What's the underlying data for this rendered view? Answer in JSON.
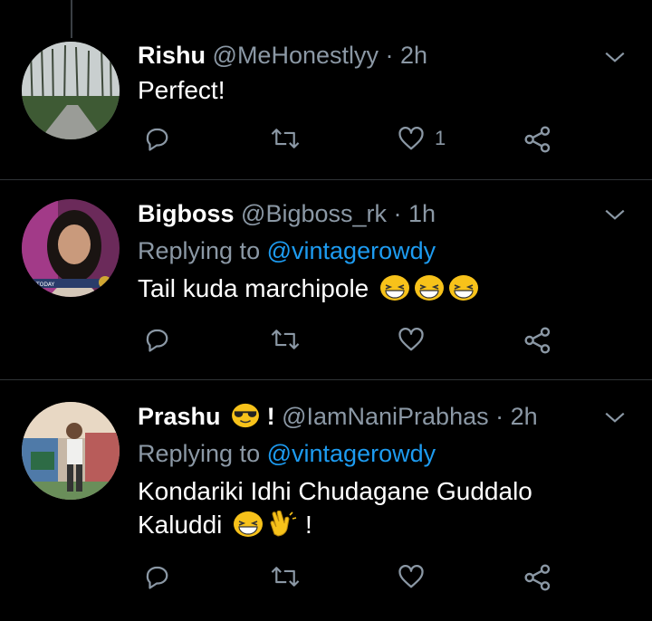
{
  "tweets": [
    {
      "name": "Rishu",
      "handle": "@MeHonestlyy",
      "time": "· 2h",
      "body": "Perfect!",
      "like_count": "1"
    },
    {
      "name": "Bigboss",
      "handle": "@Bigboss_rk",
      "time": "· 1h",
      "replying_prefix": "Replying to",
      "replying_handle": "@vintagerowdy",
      "body": "Tail kuda marchipole",
      "avatar_caption": "TODAY"
    },
    {
      "name": "Prashu",
      "name_suffix": "!",
      "handle": "@IamNaniPrabhas",
      "time": "· 2h",
      "replying_prefix": "Replying to",
      "replying_handle": "@vintagerowdy",
      "body_line1": "Kondariki Idhi Chudagane Guddalo",
      "body_line2": "Kaluddi",
      "body_end": "!"
    }
  ],
  "icons": {
    "reply": "reply-icon",
    "retweet": "retweet-icon",
    "like": "heart-icon",
    "share": "share-icon",
    "more": "chevron-down-icon"
  },
  "colors": {
    "background": "#000000",
    "muted": "#8b98a5",
    "link": "#1d9bf0",
    "divider": "#2f3336"
  }
}
